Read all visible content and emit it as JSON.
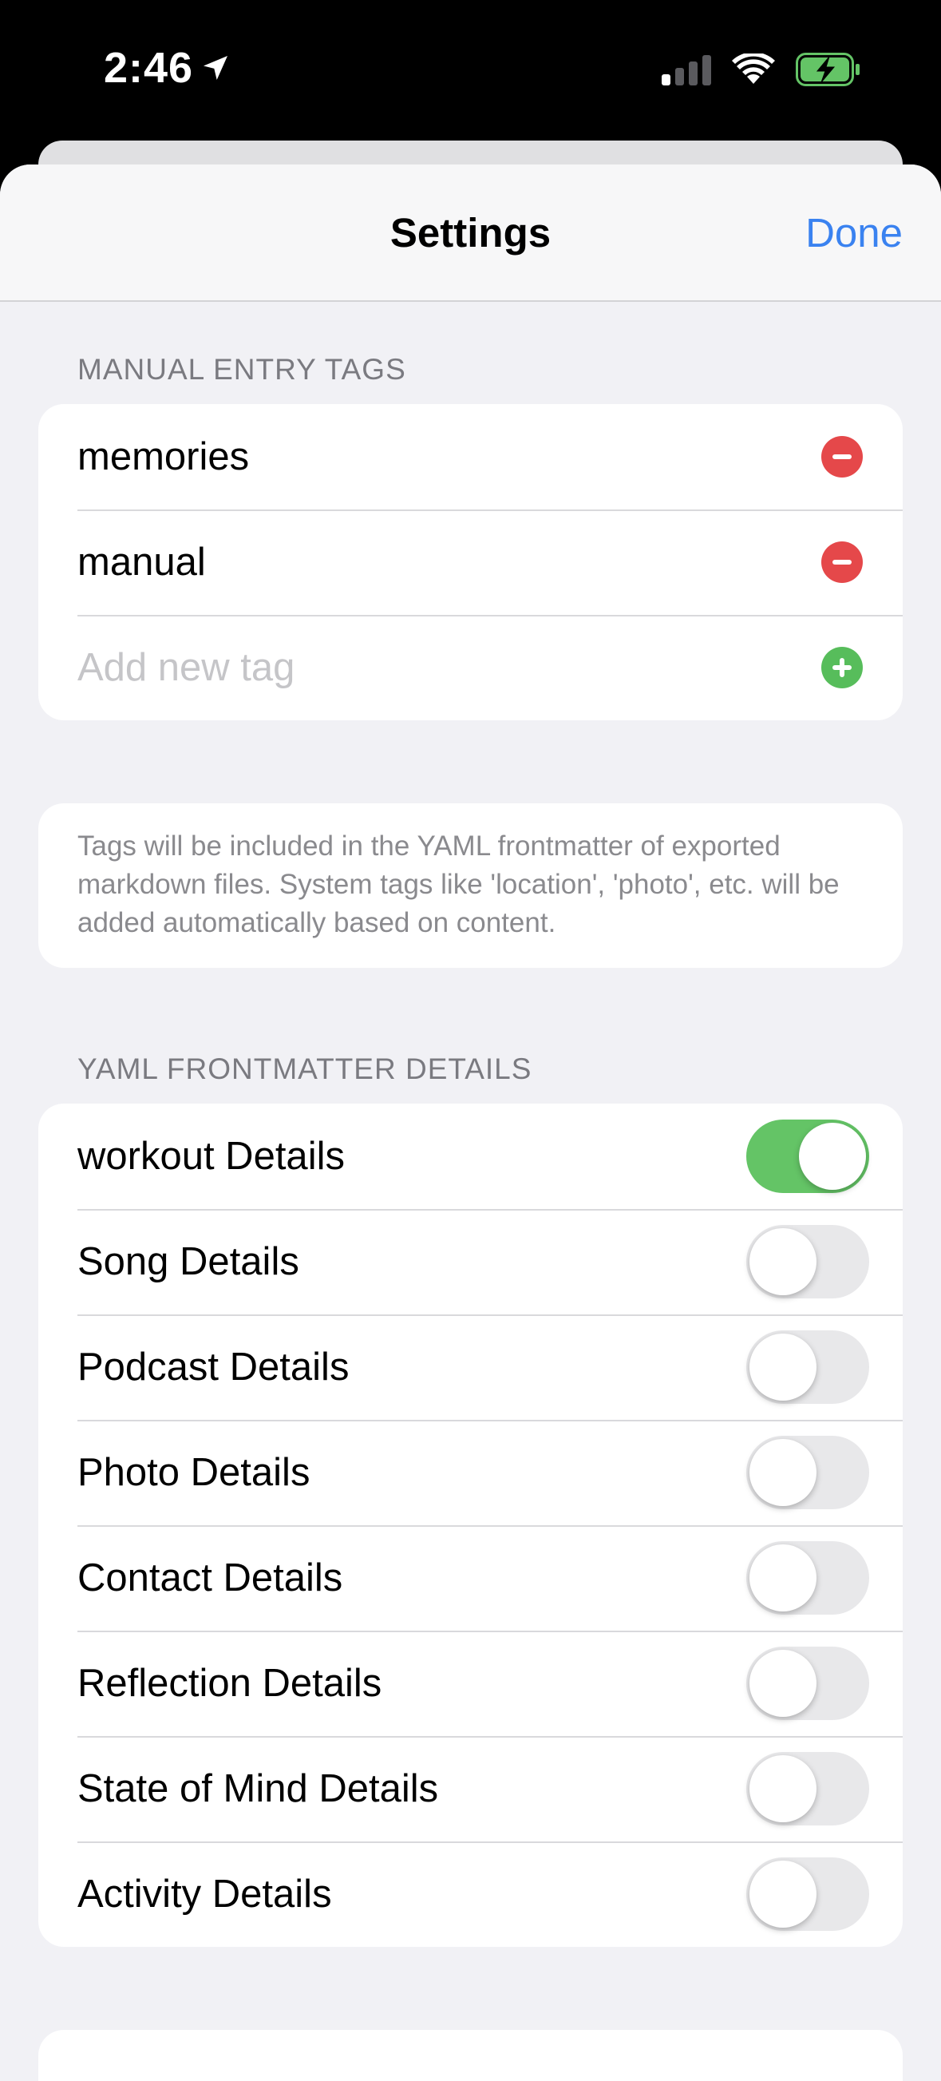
{
  "status_bar": {
    "time": "2:46"
  },
  "nav": {
    "title": "Settings",
    "done_label": "Done"
  },
  "manual_tags": {
    "header": "MANUAL ENTRY TAGS",
    "tags": [
      {
        "label": "memories"
      },
      {
        "label": "manual"
      }
    ],
    "add_placeholder": "Add new tag"
  },
  "info": {
    "text": "Tags will be included in the YAML frontmatter of exported markdown files. System tags like 'location', 'photo', etc. will be added automatically based on content."
  },
  "frontmatter": {
    "header": "YAML FRONTMATTER DETAILS",
    "items": [
      {
        "label": "workout Details",
        "on": true
      },
      {
        "label": "Song Details",
        "on": false
      },
      {
        "label": "Podcast Details",
        "on": false
      },
      {
        "label": "Photo Details",
        "on": false
      },
      {
        "label": "Contact Details",
        "on": false
      },
      {
        "label": "Reflection Details",
        "on": false
      },
      {
        "label": "State of Mind Details",
        "on": false
      },
      {
        "label": "Activity Details",
        "on": false
      }
    ]
  },
  "colors": {
    "accent": "#3a82f0",
    "toggle_on": "#64c466",
    "remove": "#e5484a",
    "add": "#57bd5b"
  }
}
